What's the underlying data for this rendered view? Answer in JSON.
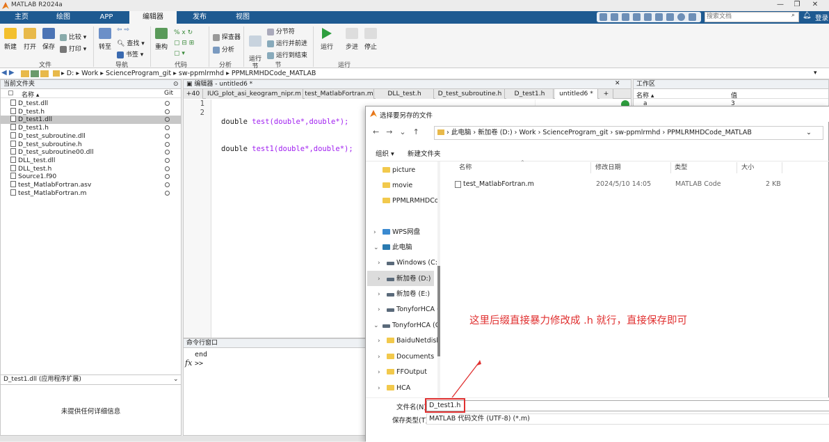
{
  "window": {
    "title": "MATLAB R2024a"
  },
  "ribbon_tabs": [
    "主页",
    "绘图",
    "APP",
    "编辑器",
    "发布",
    "视图"
  ],
  "search": {
    "placeholder": "搜索文档"
  },
  "login": "登录",
  "toolbar": {
    "new": "新建",
    "open": "打开",
    "save": "保存",
    "compare": "比较",
    "print": "打印",
    "goto": "转至",
    "find": "查找",
    "bookmark": "书签",
    "refactor": "重构",
    "profiler": "探查器",
    "analyze": "分析",
    "run_section": "运行\n节",
    "section_break": "分节符",
    "run_and_advance": "运行并前进",
    "run_to_end": "运行到结束",
    "run": "运行",
    "step": "步进",
    "stop": "停止",
    "groups": [
      "文件",
      "导航",
      "代码",
      "分析",
      "节",
      "运行"
    ]
  },
  "address": {
    "segments": [
      "D:",
      "Work",
      "ScienceProgram_git",
      "sw-ppmlrmhd",
      "PPMLRMHDCode_MATLAB"
    ]
  },
  "current_folder": {
    "title": "当前文件夹",
    "col_name": "名称",
    "col_git": "Git",
    "files": [
      "D_test.dll",
      "D_test.h",
      "D_test1.dll",
      "D_test1.h",
      "D_test_subroutine.dll",
      "D_test_subroutine.h",
      "D_test_subroutine00.dll",
      "DLL_test.dll",
      "DLL_test.h",
      "Source1.f90",
      "test_MatlabFortran.asv",
      "test_MatlabFortran.m"
    ],
    "selected": "D_test1.dll",
    "details_title": "D_test1.dll (应用程序扩展)",
    "details_text": "未提供任何详细信息"
  },
  "editor": {
    "title": "编辑器 - untitled6 *",
    "tabs": [
      "+40",
      "IUG_plot_asi_keogram_nipr.m",
      "test_MatlabFortran.m",
      "DLL_test.h",
      "D_test_subroutine.h",
      "D_test1.h",
      "untitled6 *",
      "+"
    ],
    "lines": [
      {
        "num": "1",
        "kw1": "double",
        "fn": " test(double*,double*);"
      },
      {
        "num": "2",
        "kw1": "double",
        "fn": " test1(double*,double*);"
      }
    ]
  },
  "command_window": {
    "title": "命令行窗口",
    "line1": "end",
    "prompt": ">>",
    "fx": "fx"
  },
  "workspace": {
    "title": "工作区",
    "col_name": "名称",
    "col_value": "值",
    "var": "a",
    "val": "3"
  },
  "dialog": {
    "title": "选择要另存的文件",
    "path": [
      "此电脑",
      "新加卷 (D:)",
      "Work",
      "ScienceProgram_git",
      "sw-ppmlrmhd",
      "PPMLRMHDCode_MATLAB"
    ],
    "organize": "组织",
    "new_folder": "新建文件夹",
    "nav": [
      "picture",
      "movie",
      "PPMLRMHDCo",
      "WPS网盘",
      "此电脑",
      "Windows (C:)",
      "新加卷 (D:)",
      "新加卷 (E:)",
      "TonyforHCA (",
      "TonyforHCA (G",
      "BaiduNetdisk",
      "Documents",
      "FFOutput",
      "HCA"
    ],
    "columns": [
      "名称",
      "修改日期",
      "类型",
      "大小"
    ],
    "file": {
      "name": "test_MatlabFortran.m",
      "date": "2024/5/10 14:05",
      "type": "MATLAB Code",
      "size": "2 KB"
    },
    "annotation": "这里后缀直接暴力修改成 .h 就行，直接保存即可",
    "filename_label": "文件名(N):",
    "filename_value": "D_test1.h",
    "filetype_label": "保存类型(T):",
    "filetype_value": "MATLAB 代码文件 (UTF-8) (*.m)"
  },
  "colors": {
    "ribbon_blue": "#1e5a91",
    "annotation_red": "#e03030",
    "keyword": "#a020f0"
  }
}
